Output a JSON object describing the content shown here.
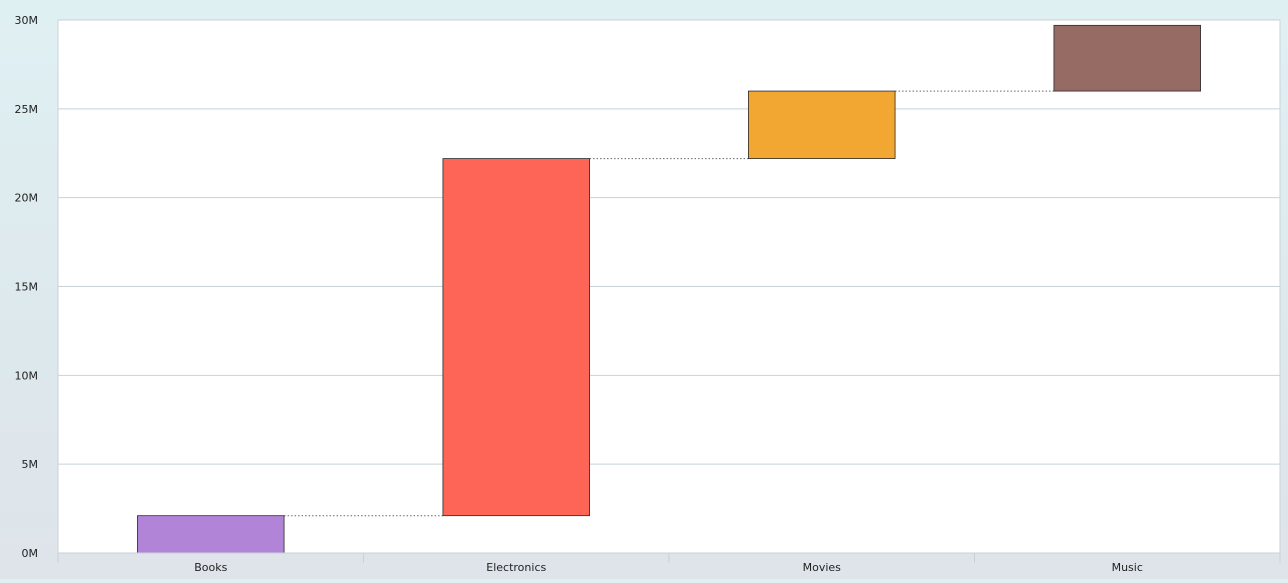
{
  "chart_data": {
    "type": "waterfall",
    "categories": [
      "Books",
      "Electronics",
      "Movies",
      "Music"
    ],
    "values": [
      2.1,
      20.1,
      3.8,
      3.7
    ],
    "cumulative_end": [
      2.1,
      22.2,
      26.0,
      29.7
    ],
    "y_tick_labels": [
      "0M",
      "5M",
      "10M",
      "15M",
      "20M",
      "25M",
      "30M"
    ],
    "y_ticks": [
      0,
      5,
      10,
      15,
      20,
      25,
      30
    ],
    "ylim": [
      0,
      30
    ],
    "colors": [
      "#b284d8",
      "#ff6557",
      "#f2a733",
      "#956b64"
    ],
    "grid": true,
    "connector_lines": "dotted"
  }
}
